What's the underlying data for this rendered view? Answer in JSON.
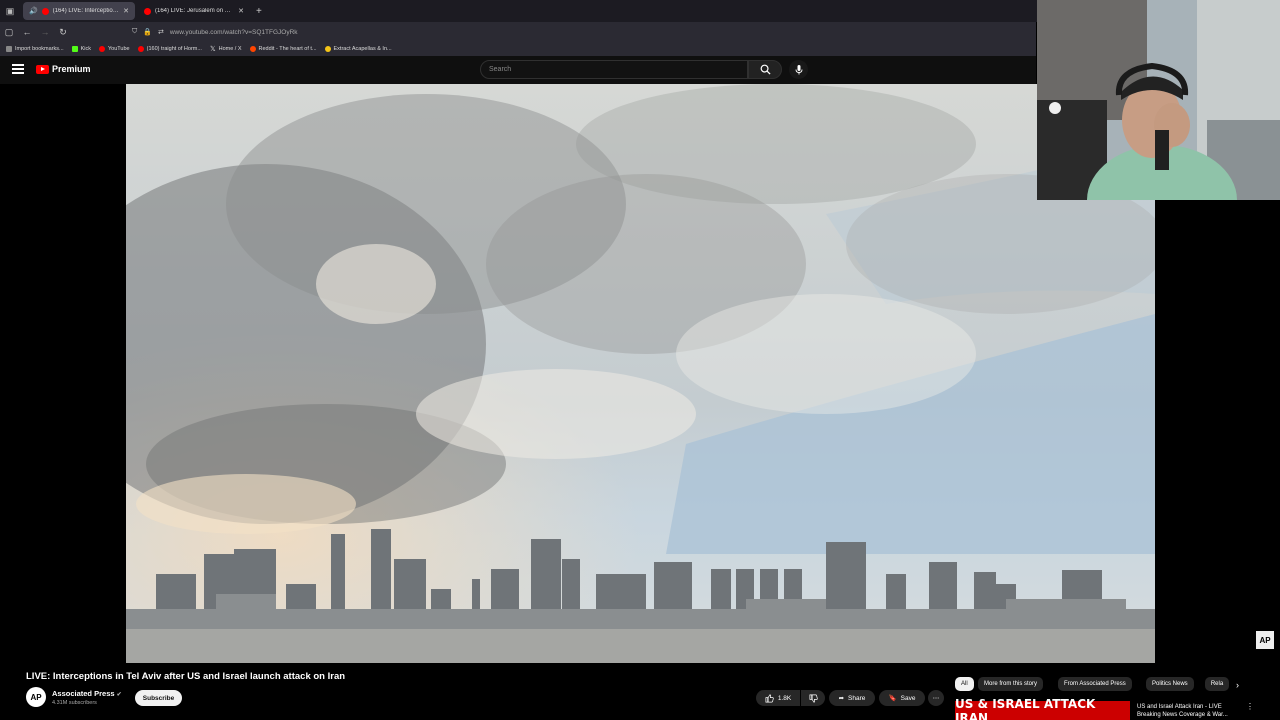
{
  "tabs": [
    {
      "label": "(164) LIVE: Interceptions in",
      "active": true
    },
    {
      "label": "(164) LIVE: Jerusalem on Alert a",
      "active": false
    }
  ],
  "address": "www.youtube.com/watch?v=SQ1TFGJOyRk",
  "bookmarks": [
    "Import bookmarks...",
    "Kick",
    "YouTube",
    "(160) traight of Horm...",
    "Home / X",
    "Reddit - The heart of t...",
    "Extract Acapellas & In..."
  ],
  "youtube": {
    "logo_text": "Premium",
    "search_placeholder": "Search"
  },
  "video": {
    "title": "LIVE: Interceptions in Tel Aviv after US and Israel launch attack on Iran",
    "channel": "Associated Press",
    "avatar_text": "AP",
    "subscribers": "4.31M subscribers",
    "subscribe_label": "Subscribe",
    "likes": "1.8K",
    "share_label": "Share",
    "save_label": "Save",
    "watermark": "AP"
  },
  "chips": [
    "All",
    "More from this story",
    "From Associated Press",
    "Politics News",
    "Rela"
  ],
  "recommendation": {
    "thumb_text": "US & ISRAEL ATTACK IRAN",
    "title": "US and Israel Attack Iran - LIVE Breaking News Coverage & War..."
  }
}
